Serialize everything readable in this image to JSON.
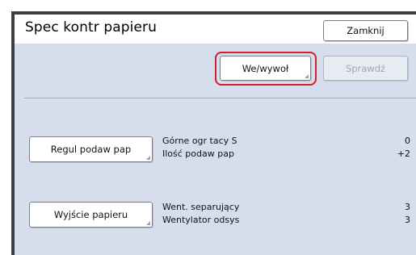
{
  "window": {
    "title": "Spec kontr papieru",
    "close_label": "Zamknij"
  },
  "toolbar": {
    "io_label": "We/wywoł",
    "check_label": "Sprawdź"
  },
  "rows": [
    {
      "button_label": "Regul podaw pap",
      "items": [
        {
          "label": "Górne ogr tacy S",
          "value": "0"
        },
        {
          "label": "Ilość podaw pap",
          "value": "+2"
        }
      ]
    },
    {
      "button_label": "Wyjście papieru",
      "items": [
        {
          "label": "Went. separujący",
          "value": "3"
        },
        {
          "label": "Wentylator odsys",
          "value": "3"
        }
      ]
    }
  ],
  "colors": {
    "highlight": "#d12229",
    "panel": "#d6deee"
  }
}
